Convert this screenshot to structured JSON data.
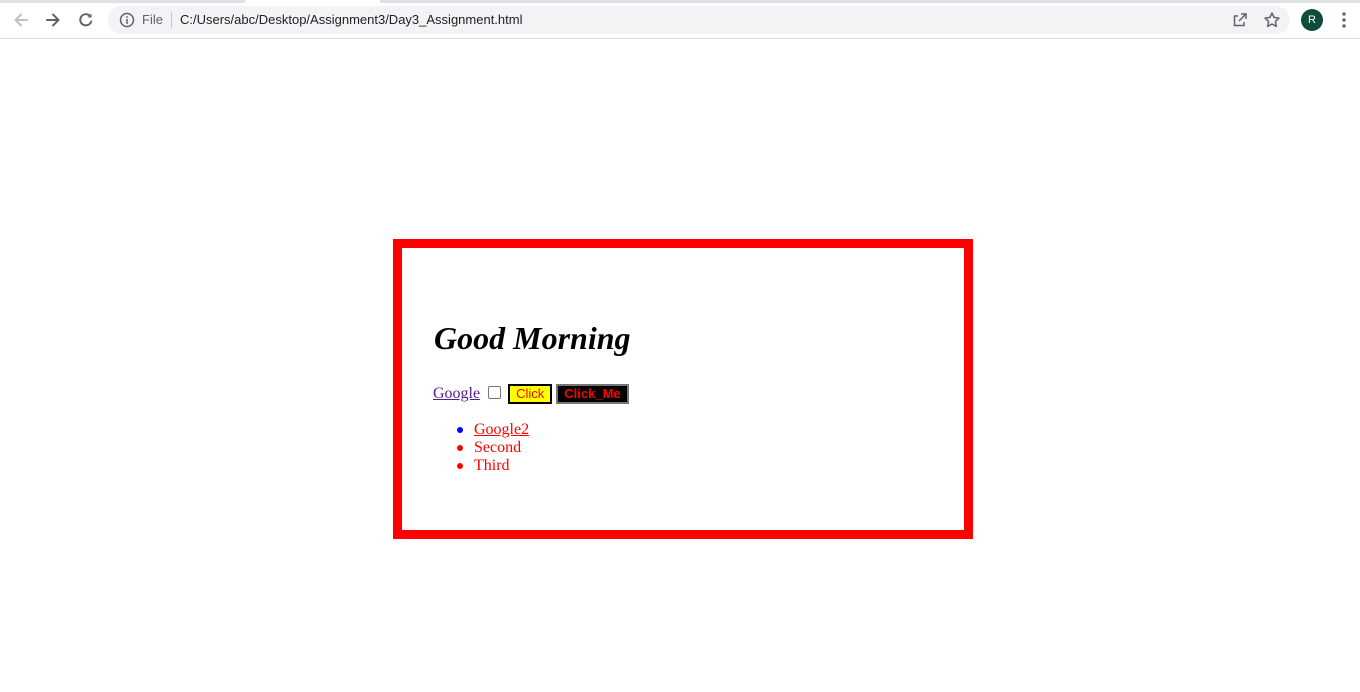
{
  "browser": {
    "scheme_label": "File",
    "url": "C:/Users/abc/Desktop/Assignment3/Day3_Assignment.html",
    "avatar_letter": "R",
    "icons": [
      "back-arrow-icon",
      "forward-arrow-icon",
      "reload-icon",
      "info-icon",
      "share-icon",
      "star-icon",
      "kebab-menu-icon"
    ]
  },
  "page": {
    "heading": "Good Morning",
    "link_label": "Google",
    "checkbox_checked": false,
    "button_click_label": "Click",
    "button_clickme_label": "Click_Me",
    "list_items": [
      {
        "label": "Google2",
        "is_link": true,
        "bullet_color": "#0000ff"
      },
      {
        "label": "Second",
        "is_link": false,
        "bullet_color": "#ff0000"
      },
      {
        "label": "Third",
        "is_link": false,
        "bullet_color": "#ff0000"
      }
    ]
  },
  "colors": {
    "box_border": "#ff0000",
    "button_click_bg": "#ffff00",
    "button_click_text": "#ff0000",
    "button_clickme_bg": "#000000",
    "button_clickme_text": "#ff0000",
    "list_text": "#ff0000",
    "avatar_bg": "#0f4c3a"
  }
}
